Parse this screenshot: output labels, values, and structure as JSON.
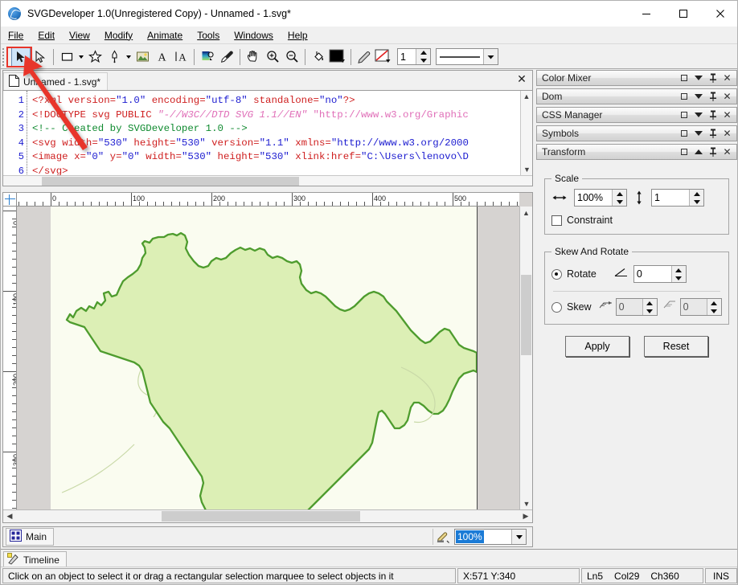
{
  "window": {
    "title": "SVGDeveloper 1.0(Unregistered Copy) - Unnamed - 1.svg*",
    "app_icon": "svg-developer-icon",
    "minimize": "minimize-icon",
    "maximize": "maximize-icon",
    "close": "close-icon"
  },
  "menu": [
    {
      "label": "File",
      "mnemonic": "F"
    },
    {
      "label": "Edit",
      "mnemonic": "E"
    },
    {
      "label": "View",
      "mnemonic": "V"
    },
    {
      "label": "Modify",
      "mnemonic": "M"
    },
    {
      "label": "Animate",
      "mnemonic": "A"
    },
    {
      "label": "Tools",
      "mnemonic": "T"
    },
    {
      "label": "Windows",
      "mnemonic": "W"
    },
    {
      "label": "Help",
      "mnemonic": "H"
    }
  ],
  "toolbar": {
    "tools": [
      {
        "name": "select-arrow-tool",
        "selected": true
      },
      {
        "name": "subselect-arrow-tool",
        "selected": false
      },
      {
        "name": "rectangle-tool",
        "selected": false
      },
      {
        "name": "star-tool",
        "selected": false
      },
      {
        "name": "pen-tool",
        "selected": false
      },
      {
        "name": "image-tool",
        "selected": false
      },
      {
        "name": "text-tool",
        "selected": false
      },
      {
        "name": "vertical-text-tool",
        "selected": false
      },
      {
        "name": "gradient-tool",
        "selected": false
      },
      {
        "name": "eyedropper-tool",
        "selected": false
      },
      {
        "name": "hand-tool",
        "selected": false
      },
      {
        "name": "zoom-in-tool",
        "selected": false
      },
      {
        "name": "zoom-out-tool",
        "selected": false
      },
      {
        "name": "paint-bucket-tool",
        "selected": false
      },
      {
        "name": "fill-color-swatch",
        "selected": false
      },
      {
        "name": "pencil-stroke-tool",
        "selected": false
      },
      {
        "name": "no-stroke-swatch",
        "selected": false
      }
    ],
    "stroke_width_value": "1",
    "stroke_style_label": ""
  },
  "editor": {
    "tab_label": "Unnamed - 1.svg*",
    "tab_icon": "document-icon",
    "close_label": "✕",
    "line_numbers": [
      "1",
      "2",
      "3",
      "4",
      "5",
      "6"
    ],
    "lines": [
      [
        {
          "t": "<?xml ",
          "c": "cs-tag"
        },
        {
          "t": "version=",
          "c": "cs-attr"
        },
        {
          "t": "\"1.0\"",
          "c": "cs-val"
        },
        {
          "t": " encoding=",
          "c": "cs-attr"
        },
        {
          "t": "\"utf-8\"",
          "c": "cs-val"
        },
        {
          "t": " standalone=",
          "c": "cs-attr"
        },
        {
          "t": "\"no\"",
          "c": "cs-val"
        },
        {
          "t": "?>",
          "c": "cs-tag"
        }
      ],
      [
        {
          "t": "<!DOCTYPE svg PUBLIC ",
          "c": "cs-tag"
        },
        {
          "t": "\"-//W3C//DTD SVG 1.1//EN\"",
          "c": "cs-dtd"
        },
        {
          "t": " \"http://www.w3.org/Graphic",
          "c": "cs-dtd2"
        }
      ],
      [
        {
          "t": "<!-- Created by SVGDeveloper 1.0 -->",
          "c": "cs-com"
        }
      ],
      [
        {
          "t": "<svg ",
          "c": "cs-tag"
        },
        {
          "t": "width=",
          "c": "cs-attr"
        },
        {
          "t": "\"530\"",
          "c": "cs-val"
        },
        {
          "t": " height=",
          "c": "cs-attr"
        },
        {
          "t": "\"530\"",
          "c": "cs-val"
        },
        {
          "t": " version=",
          "c": "cs-attr"
        },
        {
          "t": "\"1.1\"",
          "c": "cs-val"
        },
        {
          "t": " xmlns=",
          "c": "cs-attr"
        },
        {
          "t": "\"http://www.w3.org/2000",
          "c": "cs-val"
        }
      ],
      [
        {
          "t": "<image ",
          "c": "cs-tag"
        },
        {
          "t": "x=",
          "c": "cs-attr"
        },
        {
          "t": "\"0\"",
          "c": "cs-val"
        },
        {
          "t": " y=",
          "c": "cs-attr"
        },
        {
          "t": "\"0\"",
          "c": "cs-val"
        },
        {
          "t": " width=",
          "c": "cs-attr"
        },
        {
          "t": "\"530\"",
          "c": "cs-val"
        },
        {
          "t": " height=",
          "c": "cs-attr"
        },
        {
          "t": "\"530\"",
          "c": "cs-val"
        },
        {
          "t": " xlink:href=",
          "c": "cs-attr"
        },
        {
          "t": "\"C:\\Users\\lenovo\\D",
          "c": "cs-val"
        }
      ],
      [
        {
          "t": "</svg>",
          "c": "cs-tag"
        }
      ]
    ]
  },
  "canvas": {
    "hruler_labels": [
      "0",
      "100",
      "200",
      "300",
      "400",
      "500"
    ],
    "vruler_labels": [
      "0",
      "100",
      "200",
      "300"
    ],
    "map_fill": "#dcefb5",
    "map_stroke": "#4e9c2e",
    "page_background": "#fafcf0"
  },
  "mainbar": {
    "tab_label": "Main",
    "tab_icon": "scene-icon",
    "snap_icon": "snap-to-objects-icon",
    "zoom_value": "100%"
  },
  "timeline": {
    "tab_label": "Timeline",
    "tab_icon": "timeline-icon"
  },
  "status": {
    "message": "Click on an object to select it or drag a rectangular selection marquee to select objects in it",
    "coords": "X:571  Y:340",
    "line": "Ln5",
    "column": "Col29",
    "chars": "Ch360",
    "insert_mode": "INS"
  },
  "dock": {
    "panels": [
      {
        "title": "Color Mixer",
        "collapsed": true
      },
      {
        "title": "Dom",
        "collapsed": true
      },
      {
        "title": "CSS Manager",
        "collapsed": true
      },
      {
        "title": "Symbols",
        "collapsed": true
      },
      {
        "title": "Transform",
        "collapsed": false
      }
    ],
    "panel_buttons": {
      "maximize": "panel-maximize-icon",
      "collapse_down": "chevron-down-icon",
      "collapse_up": "chevron-up-icon",
      "pin": "pin-icon",
      "close": "close-icon"
    }
  },
  "transform": {
    "scale_legend": "Scale",
    "scale_x_icon": "horizontal-arrows-icon",
    "scale_x_value": "100%",
    "scale_y_icon": "vertical-arrows-icon",
    "scale_y_value": "1",
    "constraint_label": "Constraint",
    "constraint_checked": false,
    "skew_legend": "Skew And Rotate",
    "rotate_label": "Rotate",
    "rotate_selected": true,
    "rotate_icon": "angle-icon",
    "rotate_value": "0",
    "skew_label": "Skew",
    "skew_selected": false,
    "skew_h_icon": "skew-horizontal-icon",
    "skew_h_value": "0",
    "skew_v_icon": "skew-vertical-icon",
    "skew_v_value": "0",
    "apply_label": "Apply",
    "reset_label": "Reset"
  },
  "annotation": {
    "arrow_color": "#e8352a",
    "highlight_color": "#e8352a"
  }
}
